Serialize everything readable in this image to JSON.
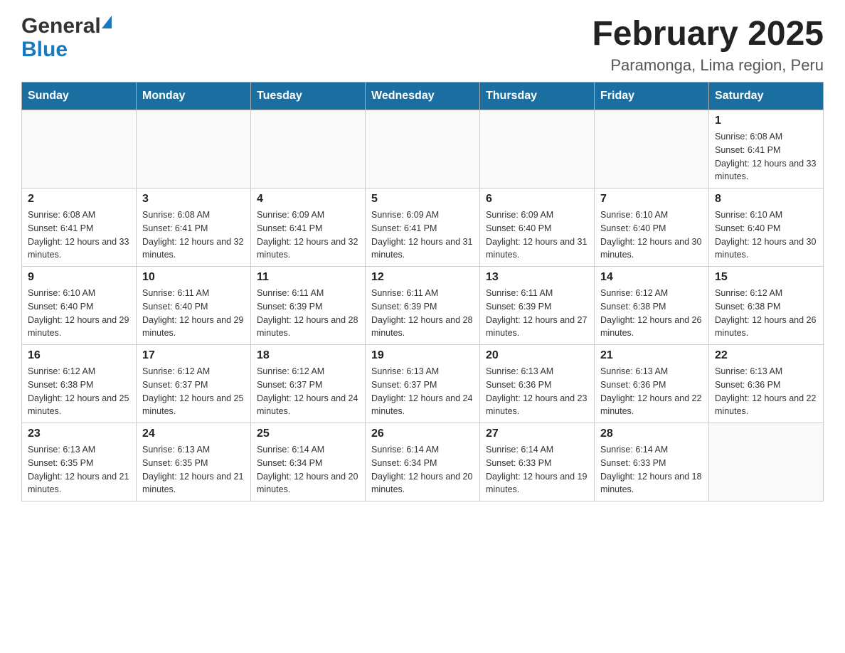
{
  "header": {
    "logo_general": "General",
    "logo_blue": "Blue",
    "month_title": "February 2025",
    "location": "Paramonga, Lima region, Peru"
  },
  "days_of_week": [
    "Sunday",
    "Monday",
    "Tuesday",
    "Wednesday",
    "Thursday",
    "Friday",
    "Saturday"
  ],
  "weeks": [
    {
      "days": [
        {
          "number": "",
          "sunrise": "",
          "sunset": "",
          "daylight": ""
        },
        {
          "number": "",
          "sunrise": "",
          "sunset": "",
          "daylight": ""
        },
        {
          "number": "",
          "sunrise": "",
          "sunset": "",
          "daylight": ""
        },
        {
          "number": "",
          "sunrise": "",
          "sunset": "",
          "daylight": ""
        },
        {
          "number": "",
          "sunrise": "",
          "sunset": "",
          "daylight": ""
        },
        {
          "number": "",
          "sunrise": "",
          "sunset": "",
          "daylight": ""
        },
        {
          "number": "1",
          "sunrise": "Sunrise: 6:08 AM",
          "sunset": "Sunset: 6:41 PM",
          "daylight": "Daylight: 12 hours and 33 minutes."
        }
      ]
    },
    {
      "days": [
        {
          "number": "2",
          "sunrise": "Sunrise: 6:08 AM",
          "sunset": "Sunset: 6:41 PM",
          "daylight": "Daylight: 12 hours and 33 minutes."
        },
        {
          "number": "3",
          "sunrise": "Sunrise: 6:08 AM",
          "sunset": "Sunset: 6:41 PM",
          "daylight": "Daylight: 12 hours and 32 minutes."
        },
        {
          "number": "4",
          "sunrise": "Sunrise: 6:09 AM",
          "sunset": "Sunset: 6:41 PM",
          "daylight": "Daylight: 12 hours and 32 minutes."
        },
        {
          "number": "5",
          "sunrise": "Sunrise: 6:09 AM",
          "sunset": "Sunset: 6:41 PM",
          "daylight": "Daylight: 12 hours and 31 minutes."
        },
        {
          "number": "6",
          "sunrise": "Sunrise: 6:09 AM",
          "sunset": "Sunset: 6:40 PM",
          "daylight": "Daylight: 12 hours and 31 minutes."
        },
        {
          "number": "7",
          "sunrise": "Sunrise: 6:10 AM",
          "sunset": "Sunset: 6:40 PM",
          "daylight": "Daylight: 12 hours and 30 minutes."
        },
        {
          "number": "8",
          "sunrise": "Sunrise: 6:10 AM",
          "sunset": "Sunset: 6:40 PM",
          "daylight": "Daylight: 12 hours and 30 minutes."
        }
      ]
    },
    {
      "days": [
        {
          "number": "9",
          "sunrise": "Sunrise: 6:10 AM",
          "sunset": "Sunset: 6:40 PM",
          "daylight": "Daylight: 12 hours and 29 minutes."
        },
        {
          "number": "10",
          "sunrise": "Sunrise: 6:11 AM",
          "sunset": "Sunset: 6:40 PM",
          "daylight": "Daylight: 12 hours and 29 minutes."
        },
        {
          "number": "11",
          "sunrise": "Sunrise: 6:11 AM",
          "sunset": "Sunset: 6:39 PM",
          "daylight": "Daylight: 12 hours and 28 minutes."
        },
        {
          "number": "12",
          "sunrise": "Sunrise: 6:11 AM",
          "sunset": "Sunset: 6:39 PM",
          "daylight": "Daylight: 12 hours and 28 minutes."
        },
        {
          "number": "13",
          "sunrise": "Sunrise: 6:11 AM",
          "sunset": "Sunset: 6:39 PM",
          "daylight": "Daylight: 12 hours and 27 minutes."
        },
        {
          "number": "14",
          "sunrise": "Sunrise: 6:12 AM",
          "sunset": "Sunset: 6:38 PM",
          "daylight": "Daylight: 12 hours and 26 minutes."
        },
        {
          "number": "15",
          "sunrise": "Sunrise: 6:12 AM",
          "sunset": "Sunset: 6:38 PM",
          "daylight": "Daylight: 12 hours and 26 minutes."
        }
      ]
    },
    {
      "days": [
        {
          "number": "16",
          "sunrise": "Sunrise: 6:12 AM",
          "sunset": "Sunset: 6:38 PM",
          "daylight": "Daylight: 12 hours and 25 minutes."
        },
        {
          "number": "17",
          "sunrise": "Sunrise: 6:12 AM",
          "sunset": "Sunset: 6:37 PM",
          "daylight": "Daylight: 12 hours and 25 minutes."
        },
        {
          "number": "18",
          "sunrise": "Sunrise: 6:12 AM",
          "sunset": "Sunset: 6:37 PM",
          "daylight": "Daylight: 12 hours and 24 minutes."
        },
        {
          "number": "19",
          "sunrise": "Sunrise: 6:13 AM",
          "sunset": "Sunset: 6:37 PM",
          "daylight": "Daylight: 12 hours and 24 minutes."
        },
        {
          "number": "20",
          "sunrise": "Sunrise: 6:13 AM",
          "sunset": "Sunset: 6:36 PM",
          "daylight": "Daylight: 12 hours and 23 minutes."
        },
        {
          "number": "21",
          "sunrise": "Sunrise: 6:13 AM",
          "sunset": "Sunset: 6:36 PM",
          "daylight": "Daylight: 12 hours and 22 minutes."
        },
        {
          "number": "22",
          "sunrise": "Sunrise: 6:13 AM",
          "sunset": "Sunset: 6:36 PM",
          "daylight": "Daylight: 12 hours and 22 minutes."
        }
      ]
    },
    {
      "days": [
        {
          "number": "23",
          "sunrise": "Sunrise: 6:13 AM",
          "sunset": "Sunset: 6:35 PM",
          "daylight": "Daylight: 12 hours and 21 minutes."
        },
        {
          "number": "24",
          "sunrise": "Sunrise: 6:13 AM",
          "sunset": "Sunset: 6:35 PM",
          "daylight": "Daylight: 12 hours and 21 minutes."
        },
        {
          "number": "25",
          "sunrise": "Sunrise: 6:14 AM",
          "sunset": "Sunset: 6:34 PM",
          "daylight": "Daylight: 12 hours and 20 minutes."
        },
        {
          "number": "26",
          "sunrise": "Sunrise: 6:14 AM",
          "sunset": "Sunset: 6:34 PM",
          "daylight": "Daylight: 12 hours and 20 minutes."
        },
        {
          "number": "27",
          "sunrise": "Sunrise: 6:14 AM",
          "sunset": "Sunset: 6:33 PM",
          "daylight": "Daylight: 12 hours and 19 minutes."
        },
        {
          "number": "28",
          "sunrise": "Sunrise: 6:14 AM",
          "sunset": "Sunset: 6:33 PM",
          "daylight": "Daylight: 12 hours and 18 minutes."
        },
        {
          "number": "",
          "sunrise": "",
          "sunset": "",
          "daylight": ""
        }
      ]
    }
  ]
}
